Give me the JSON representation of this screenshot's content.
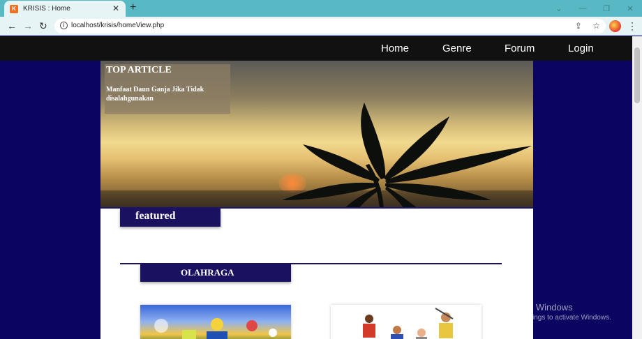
{
  "browser": {
    "tab_title": "KRISIS : Home",
    "favicon_letter": "K",
    "url": "localhost/krisis/homeView.php"
  },
  "nav": {
    "items": [
      {
        "label": "Home"
      },
      {
        "label": "Genre"
      },
      {
        "label": "Forum"
      },
      {
        "label": "Login"
      }
    ]
  },
  "hero": {
    "heading": "TOP ARTICLE",
    "article_title": "Manfaat Daun Ganja Jika Tidak disalahgunakan"
  },
  "featured": {
    "label": "featured"
  },
  "section": {
    "label": "OLAHRAGA"
  },
  "watermark": {
    "title": "Activate Windows",
    "subtitle": "Go to Settings to activate Windows."
  },
  "colors": {
    "page_bg": "#0a0560",
    "nav_bg": "#111111",
    "accent": "#1a1160",
    "tab_bar": "#58b9c4"
  }
}
